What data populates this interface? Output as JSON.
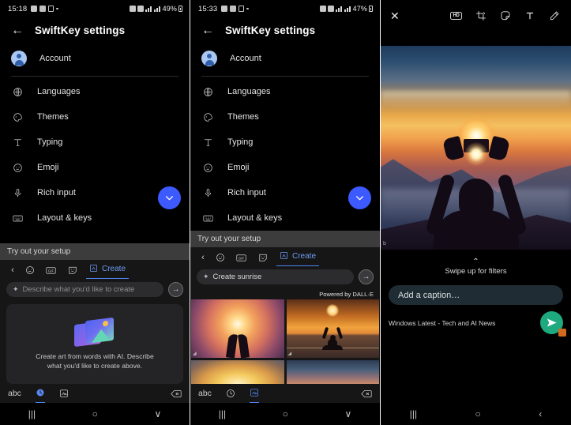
{
  "panel1": {
    "status": {
      "time": "15:18",
      "battery": "49%",
      "icons": [
        "gallery-icon",
        "checkbox-icon",
        "lock-icon",
        "dot-icon",
        "alarm-icon",
        "mute-icon",
        "wifi-icon",
        "signal-icon"
      ]
    },
    "appbar": {
      "back": "←",
      "title": "SwiftKey settings"
    },
    "settings": [
      {
        "label": "Account",
        "icon": "avatar-icon"
      },
      {
        "label": "Languages",
        "icon": "globe-icon"
      },
      {
        "label": "Themes",
        "icon": "palette-icon"
      },
      {
        "label": "Typing",
        "icon": "text-t-icon"
      },
      {
        "label": "Emoji",
        "icon": "smiley-icon"
      },
      {
        "label": "Rich input",
        "icon": "microphone-icon"
      },
      {
        "label": "Layout & keys",
        "icon": "keyboard-icon"
      }
    ],
    "fab": {
      "icon": "chevron-down-icon",
      "color": "#3d5afe"
    },
    "keyboard": {
      "hint": "Try out your setup",
      "toolbar": {
        "back": "‹",
        "emoji": "emoji-icon",
        "gif": "GIF",
        "sticker": "sticker-icon",
        "create_label": "Create"
      },
      "input": {
        "value": "",
        "placeholder": "Describe what you'd like to create"
      },
      "send": "→",
      "empty_card": {
        "line1": "Create art from words with AI. Describe",
        "line2": "what you'd like to create above."
      },
      "bottom": {
        "abc": "abc",
        "clock": "clock-icon",
        "image": "image-icon",
        "backspace": "backspace-icon",
        "selected": "clock"
      }
    },
    "nav": {
      "recents": "|||",
      "home": "○",
      "down": "∨"
    }
  },
  "panel2": {
    "status": {
      "time": "15:33",
      "battery": "47%"
    },
    "appbar": {
      "back": "←",
      "title": "SwiftKey settings"
    },
    "settings": [
      {
        "label": "Account",
        "icon": "avatar-icon"
      },
      {
        "label": "Languages",
        "icon": "globe-icon"
      },
      {
        "label": "Themes",
        "icon": "palette-icon"
      },
      {
        "label": "Typing",
        "icon": "text-t-icon"
      },
      {
        "label": "Emoji",
        "icon": "smiley-icon"
      },
      {
        "label": "Rich input",
        "icon": "microphone-icon"
      },
      {
        "label": "Layout & keys",
        "icon": "keyboard-icon"
      }
    ],
    "fab": {
      "icon": "chevron-down-icon",
      "color": "#3d5afe"
    },
    "keyboard": {
      "hint": "Try out your setup",
      "toolbar": {
        "back": "‹",
        "create_label": "Create"
      },
      "input": {
        "value": "Create sunrise",
        "placeholder": "Describe what you'd like to create"
      },
      "send": "→",
      "powered_by": "Powered by DALL·E",
      "results": [
        {
          "alt": "hands-holding-light-sunrise"
        },
        {
          "alt": "meditating-figure-sunrise"
        },
        {
          "alt": "golden-rays-sunrise"
        },
        {
          "alt": "blue-horizon-sunrise"
        }
      ],
      "bottom": {
        "abc": "abc",
        "clock": "clock-icon",
        "image": "image-icon",
        "backspace": "backspace-icon",
        "selected": "image"
      }
    },
    "nav": {
      "recents": "|||",
      "home": "○",
      "down": "∨"
    }
  },
  "panel3": {
    "toolbar": {
      "close": "✕",
      "tools": [
        {
          "name": "hd-quality-icon",
          "label": "HD"
        },
        {
          "name": "crop-rotate-icon",
          "label": ""
        },
        {
          "name": "sticker-icon",
          "label": ""
        },
        {
          "name": "text-tool-icon",
          "label": "T"
        },
        {
          "name": "pencil-draw-icon",
          "label": ""
        }
      ]
    },
    "photo": {
      "alt": "person-silhouette-photographing-sunrise",
      "watermark": "b"
    },
    "filters": {
      "chevron": "⌃",
      "label": "Swipe up for filters"
    },
    "caption": {
      "placeholder": "Add a caption…"
    },
    "recipient": "Windows Latest - Tech and AI News",
    "send": {
      "icon": "send-icon",
      "color": "#1fa97e"
    },
    "nav": {
      "recents": "|||",
      "home": "○",
      "back": "‹"
    }
  }
}
